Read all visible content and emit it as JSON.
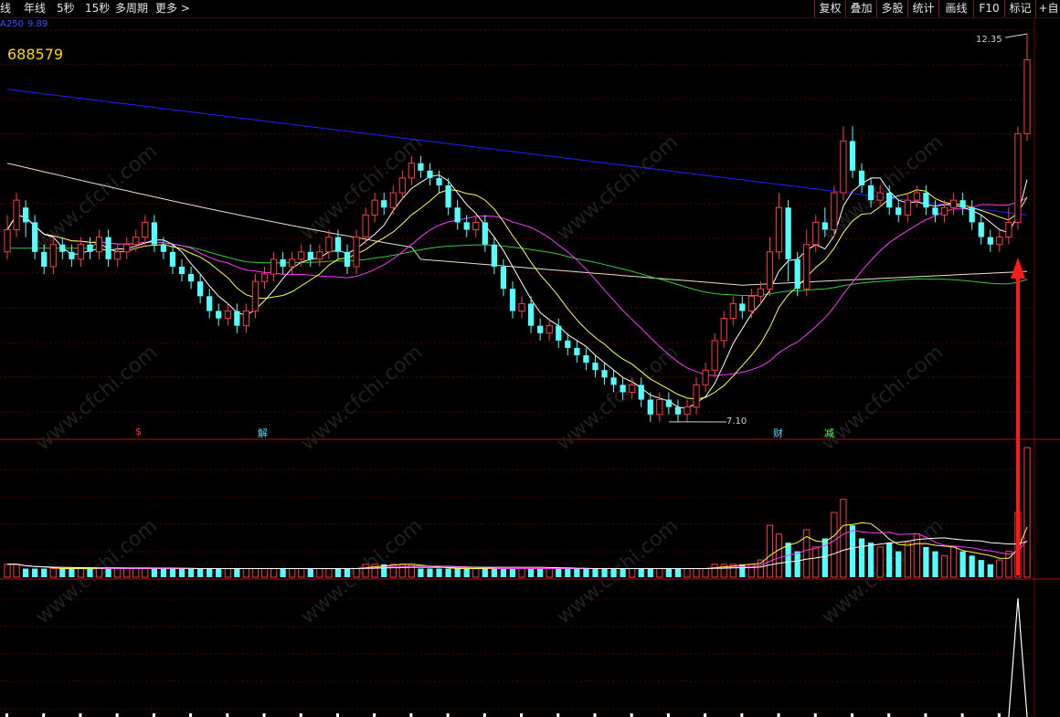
{
  "toolbar": {
    "tabs": [
      "线",
      "年线",
      "5秒",
      "15秒",
      "多周期",
      "更多 >"
    ],
    "buttons": [
      "复权",
      "叠加",
      "多股",
      "统计",
      "画线",
      "F10",
      "标记",
      "+自选"
    ]
  },
  "stock": {
    "code": "688579"
  },
  "indicator": {
    "ma_label": "A250",
    "ma_value": "9.89"
  },
  "annotations": {
    "high_label": "12.35",
    "low_label": "7.10"
  },
  "events": [
    {
      "label": "$",
      "color": "#ff3030"
    },
    {
      "label": "解",
      "color": "#40e0ff"
    },
    {
      "label": "财",
      "color": "#40e0ff"
    },
    {
      "label": "减",
      "color": "#66ff66"
    }
  ],
  "watermark": "www.cfchi.com",
  "colors": {
    "up": "#ff3b3b",
    "down": "#54ffff",
    "ma250": "#2020ff",
    "ma120": "#e8e0c0",
    "ma60": "#33cc33",
    "ma20": "#ff33ff",
    "ma5": "#ffffff",
    "ma10": "#ffff44",
    "grid": "#5a0000"
  },
  "chart_data": {
    "type": "candlestick",
    "y_range": [
      6.9,
      12.5
    ],
    "high": 12.35,
    "low": 7.1,
    "candles": [
      [
        9.4,
        9.7,
        9.9,
        9.3
      ],
      [
        9.7,
        10.1,
        10.2,
        9.6
      ],
      [
        10.0,
        9.8,
        10.1,
        9.6
      ],
      [
        9.8,
        9.4,
        9.9,
        9.3
      ],
      [
        9.4,
        9.2,
        9.5,
        9.1
      ],
      [
        9.2,
        9.5,
        9.6,
        9.1
      ],
      [
        9.5,
        9.4,
        9.6,
        9.3
      ],
      [
        9.4,
        9.3,
        9.5,
        9.2
      ],
      [
        9.3,
        9.5,
        9.6,
        9.2
      ],
      [
        9.5,
        9.4,
        9.6,
        9.3
      ],
      [
        9.4,
        9.6,
        9.7,
        9.3
      ],
      [
        9.6,
        9.3,
        9.7,
        9.2
      ],
      [
        9.3,
        9.4,
        9.5,
        9.2
      ],
      [
        9.4,
        9.5,
        9.6,
        9.3
      ],
      [
        9.5,
        9.6,
        9.7,
        9.4
      ],
      [
        9.6,
        9.8,
        9.9,
        9.5
      ],
      [
        9.8,
        9.5,
        9.9,
        9.4
      ],
      [
        9.5,
        9.4,
        9.6,
        9.3
      ],
      [
        9.4,
        9.2,
        9.5,
        9.1
      ],
      [
        9.2,
        9.1,
        9.3,
        9.0
      ],
      [
        9.1,
        9.0,
        9.2,
        8.9
      ],
      [
        9.0,
        8.8,
        9.1,
        8.7
      ],
      [
        8.8,
        8.6,
        8.9,
        8.5
      ],
      [
        8.6,
        8.5,
        8.7,
        8.4
      ],
      [
        8.5,
        8.6,
        8.7,
        8.4
      ],
      [
        8.6,
        8.4,
        8.7,
        8.3
      ],
      [
        8.4,
        8.6,
        8.7,
        8.3
      ],
      [
        8.6,
        9.0,
        9.1,
        8.5
      ],
      [
        9.0,
        9.1,
        9.2,
        8.9
      ],
      [
        9.1,
        9.3,
        9.4,
        9.0
      ],
      [
        9.3,
        9.2,
        9.4,
        9.1
      ],
      [
        9.2,
        9.3,
        9.4,
        9.1
      ],
      [
        9.3,
        9.4,
        9.5,
        9.2
      ],
      [
        9.4,
        9.3,
        9.5,
        9.2
      ],
      [
        9.3,
        9.4,
        9.5,
        9.2
      ],
      [
        9.4,
        9.6,
        9.7,
        9.3
      ],
      [
        9.6,
        9.4,
        9.7,
        9.3
      ],
      [
        9.4,
        9.2,
        9.5,
        9.1
      ],
      [
        9.2,
        9.6,
        9.7,
        9.1
      ],
      [
        9.6,
        9.9,
        10.0,
        9.5
      ],
      [
        9.9,
        10.1,
        10.2,
        9.8
      ],
      [
        10.1,
        10.0,
        10.2,
        9.9
      ],
      [
        10.0,
        10.2,
        10.3,
        9.9
      ],
      [
        10.2,
        10.4,
        10.5,
        10.1
      ],
      [
        10.4,
        10.6,
        10.7,
        10.3
      ],
      [
        10.6,
        10.5,
        10.7,
        10.4
      ],
      [
        10.5,
        10.4,
        10.6,
        10.3
      ],
      [
        10.4,
        10.3,
        10.5,
        10.2
      ],
      [
        10.3,
        10.0,
        10.4,
        9.9
      ],
      [
        10.0,
        9.8,
        10.1,
        9.7
      ],
      [
        9.8,
        9.7,
        9.9,
        9.6
      ],
      [
        9.7,
        9.8,
        9.9,
        9.6
      ],
      [
        9.8,
        9.5,
        9.9,
        9.4
      ],
      [
        9.5,
        9.2,
        9.6,
        9.1
      ],
      [
        9.2,
        8.9,
        9.3,
        8.8
      ],
      [
        8.9,
        8.6,
        9.0,
        8.5
      ],
      [
        8.6,
        8.7,
        8.8,
        8.5
      ],
      [
        8.7,
        8.4,
        8.8,
        8.3
      ],
      [
        8.4,
        8.3,
        8.5,
        8.2
      ],
      [
        8.3,
        8.4,
        8.5,
        8.2
      ],
      [
        8.4,
        8.2,
        8.5,
        8.1
      ],
      [
        8.2,
        8.1,
        8.3,
        8.0
      ],
      [
        8.1,
        8.0,
        8.2,
        7.9
      ],
      [
        8.0,
        7.9,
        8.1,
        7.8
      ],
      [
        7.9,
        7.8,
        8.0,
        7.7
      ],
      [
        7.8,
        7.7,
        7.9,
        7.6
      ],
      [
        7.7,
        7.6,
        7.8,
        7.5
      ],
      [
        7.6,
        7.5,
        7.7,
        7.4
      ],
      [
        7.5,
        7.6,
        7.7,
        7.4
      ],
      [
        7.6,
        7.4,
        7.7,
        7.3
      ],
      [
        7.4,
        7.2,
        7.5,
        7.1
      ],
      [
        7.2,
        7.4,
        7.5,
        7.1
      ],
      [
        7.4,
        7.3,
        7.5,
        7.2
      ],
      [
        7.3,
        7.2,
        7.4,
        7.1
      ],
      [
        7.2,
        7.3,
        7.4,
        7.1
      ],
      [
        7.3,
        7.6,
        7.7,
        7.2
      ],
      [
        7.6,
        7.8,
        7.9,
        7.5
      ],
      [
        7.8,
        8.2,
        8.3,
        7.7
      ],
      [
        8.2,
        8.5,
        8.6,
        8.1
      ],
      [
        8.5,
        8.7,
        8.8,
        8.4
      ],
      [
        8.7,
        8.6,
        8.8,
        8.5
      ],
      [
        8.6,
        8.8,
        8.9,
        8.5
      ],
      [
        8.8,
        8.9,
        9.0,
        8.7
      ],
      [
        8.9,
        9.4,
        9.6,
        8.8
      ],
      [
        9.4,
        10.0,
        10.2,
        9.3
      ],
      [
        10.0,
        9.3,
        10.1,
        9.0
      ],
      [
        9.3,
        8.9,
        9.4,
        8.8
      ],
      [
        8.9,
        9.5,
        9.7,
        8.8
      ],
      [
        9.5,
        9.8,
        9.9,
        9.4
      ],
      [
        9.8,
        9.7,
        10.0,
        9.6
      ],
      [
        9.7,
        10.2,
        10.3,
        9.6
      ],
      [
        10.2,
        10.9,
        11.1,
        10.1
      ],
      [
        10.9,
        10.5,
        11.1,
        10.4
      ],
      [
        10.5,
        10.3,
        10.6,
        10.2
      ],
      [
        10.3,
        10.1,
        10.4,
        10.0
      ],
      [
        10.1,
        10.2,
        10.3,
        10.0
      ],
      [
        10.2,
        10.0,
        10.3,
        9.9
      ],
      [
        10.0,
        9.9,
        10.1,
        9.8
      ],
      [
        9.9,
        10.1,
        10.2,
        9.8
      ],
      [
        10.1,
        10.2,
        10.3,
        10.0
      ],
      [
        10.2,
        10.0,
        10.3,
        9.9
      ],
      [
        10.0,
        9.9,
        10.1,
        9.8
      ],
      [
        9.9,
        10.0,
        10.1,
        9.8
      ],
      [
        10.0,
        10.1,
        10.2,
        9.9
      ],
      [
        10.1,
        10.0,
        10.2,
        9.9
      ],
      [
        10.0,
        9.8,
        10.1,
        9.7
      ],
      [
        9.8,
        9.6,
        9.9,
        9.5
      ],
      [
        9.6,
        9.5,
        9.7,
        9.4
      ],
      [
        9.5,
        9.6,
        9.7,
        9.4
      ],
      [
        9.6,
        9.8,
        10.0,
        9.5
      ],
      [
        9.8,
        11.0,
        11.1,
        9.7
      ],
      [
        11.0,
        12.0,
        12.35,
        10.9
      ]
    ],
    "volumes": [
      3,
      3,
      2,
      2,
      2,
      2,
      2,
      2,
      2,
      2,
      2,
      2,
      2,
      2,
      2,
      2,
      2,
      2,
      2,
      2,
      2,
      2,
      2,
      2,
      2,
      2,
      2,
      2,
      2,
      2,
      2,
      2,
      2,
      2,
      2,
      2,
      2,
      2,
      2,
      3,
      3,
      3,
      3,
      3,
      3,
      2,
      2,
      2,
      2,
      2,
      2,
      2,
      2,
      2,
      2,
      2,
      2,
      2,
      2,
      2,
      2,
      2,
      2,
      2,
      2,
      2,
      2,
      2,
      2,
      2,
      2,
      2,
      2,
      2,
      2,
      2,
      2,
      3,
      3,
      3,
      3,
      3,
      4,
      12,
      10,
      8,
      6,
      11,
      7,
      9,
      15,
      18,
      12,
      9,
      8,
      7,
      8,
      6,
      8,
      10,
      7,
      6,
      5,
      7,
      6,
      5,
      4,
      3,
      4,
      6,
      15,
      30
    ]
  }
}
